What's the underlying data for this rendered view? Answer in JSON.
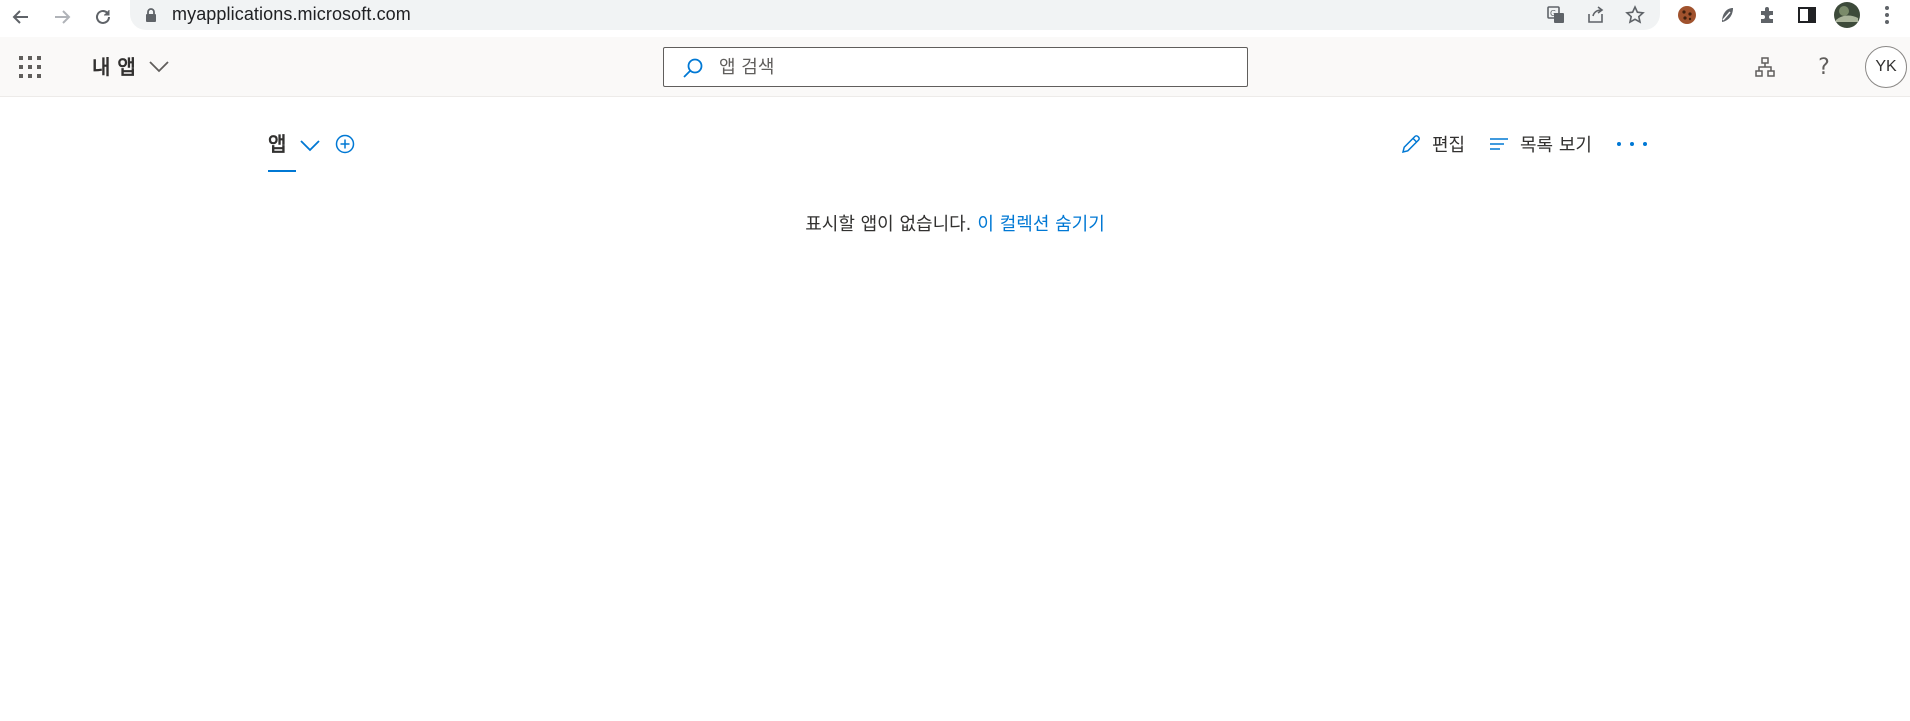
{
  "browser": {
    "url": "myapplications.microsoft.com"
  },
  "header": {
    "title": "내 앱",
    "search_placeholder": "앱 검색",
    "avatar_initials": "YK",
    "help_label": "?"
  },
  "collection": {
    "tab_label": "앱"
  },
  "toolbar": {
    "edit_label": "편집",
    "list_view_label": "목록 보기"
  },
  "empty_state": {
    "message": "표시할 앱이 없습니다.",
    "hide_link": "이 컬렉션 숨기기"
  },
  "colors": {
    "accent": "#0078d4",
    "header_bg": "#faf9f8",
    "text": "#323130"
  }
}
